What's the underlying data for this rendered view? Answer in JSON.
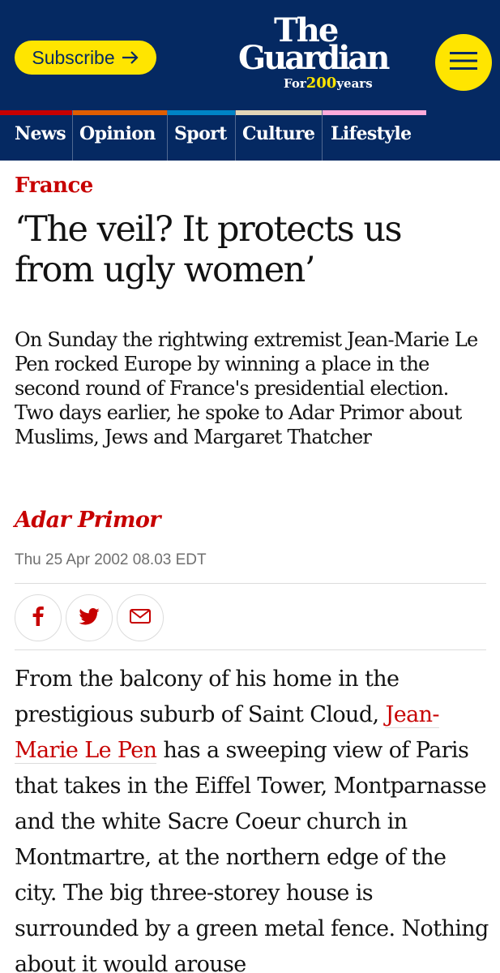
{
  "header": {
    "subscribe_label": "Subscribe",
    "logo_line1": "The",
    "logo_line2": "Guardian",
    "logo_for": "For",
    "logo_years_num": "200",
    "logo_years": "years"
  },
  "nav": {
    "items": [
      {
        "label": "News",
        "color": "#c70000"
      },
      {
        "label": "Opinion",
        "color": "#e05e00"
      },
      {
        "label": "Sport",
        "color": "#0084c6"
      },
      {
        "label": "Culture",
        "color": "#a1845c"
      },
      {
        "label": "Lifestyle",
        "color": "#bb3b80"
      }
    ]
  },
  "article": {
    "kicker": "France",
    "headline": "‘The veil? It protects us from ugly women’",
    "standfirst": "On Sunday the rightwing extremist Jean-Marie Le Pen rocked Europe by winning a place in the second round of France's presidential election. Two days earlier, he spoke to Adar Primor about Muslims, Jews and Margaret Thatcher",
    "byline": "Adar Primor",
    "date": "Thu 25 Apr 2002 08.03 EDT",
    "share": [
      "facebook-icon",
      "twitter-icon",
      "email-icon"
    ],
    "body_before": "From the balcony of his home in the prestigious suburb of Saint Cloud, ",
    "body_link": "Jean-Marie Le Pen",
    "body_after": " has a sweeping view of Paris that takes in the Eiffel Tower, Montparnasse and the white Sacre Coeur church in Montmartre, at the northern edge of the city. The big three-storey house is surrounded by a green metal fence. Nothing about it would arouse"
  },
  "colors": {
    "brand_blue": "#052962",
    "accent_yellow": "#ffe500",
    "news_red": "#c70000"
  }
}
